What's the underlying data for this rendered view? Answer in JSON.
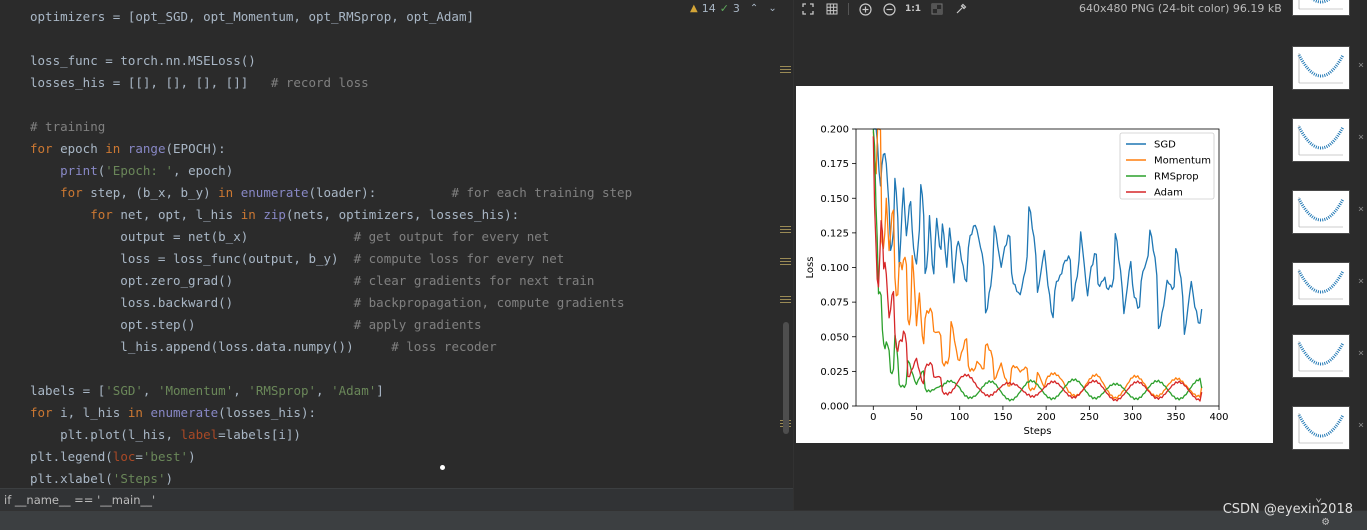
{
  "editor": {
    "lines": [
      [
        [
          "optimizers = [opt_SGD, opt_Momentum, opt_RMSprop, opt_Adam]",
          "plain"
        ]
      ],
      [],
      [
        [
          "loss_func = torch.nn.MSELoss()",
          "plain"
        ]
      ],
      [
        [
          "losses_his = [[], [], [], []]   ",
          "plain"
        ],
        [
          "# record loss",
          "com"
        ]
      ],
      [],
      [
        [
          "# training",
          "com"
        ]
      ],
      [
        [
          "for",
          "kw"
        ],
        [
          " epoch ",
          "plain"
        ],
        [
          "in",
          "kw"
        ],
        [
          " ",
          "plain"
        ],
        [
          "range",
          "fn"
        ],
        [
          "(EPOCH):",
          "plain"
        ]
      ],
      [
        [
          "    ",
          "plain"
        ],
        [
          "print",
          "fn"
        ],
        [
          "(",
          "plain"
        ],
        [
          "'Epoch: '",
          "str"
        ],
        [
          ", epoch)",
          "plain"
        ]
      ],
      [
        [
          "    ",
          "plain"
        ],
        [
          "for",
          "kw"
        ],
        [
          " step, (b_x, b_y) ",
          "plain"
        ],
        [
          "in",
          "kw"
        ],
        [
          " ",
          "plain"
        ],
        [
          "enumerate",
          "fn"
        ],
        [
          "(loader):          ",
          "plain"
        ],
        [
          "# for each training step",
          "com"
        ]
      ],
      [
        [
          "        ",
          "plain"
        ],
        [
          "for",
          "kw"
        ],
        [
          " net, opt, l_his ",
          "plain"
        ],
        [
          "in",
          "kw"
        ],
        [
          " ",
          "plain"
        ],
        [
          "zip",
          "fn"
        ],
        [
          "(nets, optimizers, losses_his):",
          "plain"
        ]
      ],
      [
        [
          "            output = net(b_x)              ",
          "plain"
        ],
        [
          "# get output for every net",
          "com"
        ]
      ],
      [
        [
          "            loss = loss_func(output, b_y)  ",
          "plain"
        ],
        [
          "# compute loss for every net",
          "com"
        ]
      ],
      [
        [
          "            opt.zero_grad()                ",
          "plain"
        ],
        [
          "# clear gradients for next train",
          "com"
        ]
      ],
      [
        [
          "            loss.backward()                ",
          "plain"
        ],
        [
          "# backpropagation, compute gradients",
          "com"
        ]
      ],
      [
        [
          "            opt.step()                     ",
          "plain"
        ],
        [
          "# apply gradients",
          "com"
        ]
      ],
      [
        [
          "            l_his.append(loss.data.numpy())     ",
          "plain"
        ],
        [
          "# loss recoder",
          "com"
        ]
      ],
      [],
      [
        [
          "labels = [",
          "plain"
        ],
        [
          "'SGD'",
          "str"
        ],
        [
          ", ",
          "plain"
        ],
        [
          "'Momentum'",
          "str"
        ],
        [
          ", ",
          "plain"
        ],
        [
          "'RMSprop'",
          "str"
        ],
        [
          ", ",
          "plain"
        ],
        [
          "'Adam'",
          "str"
        ],
        [
          "]",
          "plain"
        ]
      ],
      [
        [
          "for",
          "kw"
        ],
        [
          " i, l_his ",
          "plain"
        ],
        [
          "in",
          "kw"
        ],
        [
          " ",
          "plain"
        ],
        [
          "enumerate",
          "fn"
        ],
        [
          "(losses_his):",
          "plain"
        ]
      ],
      [
        [
          "    plt.plot(l_his, ",
          "plain"
        ],
        [
          "label",
          "param"
        ],
        [
          "=labels[i])",
          "plain"
        ]
      ],
      [
        [
          "plt.legend(",
          "plain"
        ],
        [
          "loc",
          "param"
        ],
        [
          "=",
          "plain"
        ],
        [
          "'best'",
          "str"
        ],
        [
          ")",
          "plain"
        ]
      ],
      [
        [
          "plt.xlabel(",
          "plain"
        ],
        [
          "'Steps'",
          "str"
        ],
        [
          ")",
          "plain"
        ]
      ]
    ],
    "warnings_count": "14",
    "ok_count": "3",
    "breadcrumb": "if __name__ == '__main__'"
  },
  "viewer": {
    "image_info": "640x480 PNG (24-bit color) 96.19 kB",
    "toolbar_icons": [
      "fit-screen-icon",
      "grid-icon",
      "zoom-in-icon",
      "zoom-out-icon",
      "actual-size-icon",
      "background-icon",
      "color-picker-icon"
    ],
    "actual_size_label": "1:1"
  },
  "watermark": "CSDN @eyexin2018",
  "chart_data": {
    "type": "line",
    "xlabel": "Steps",
    "ylabel": "Loss",
    "xlim": [
      -20,
      400
    ],
    "ylim": [
      0.0,
      0.2
    ],
    "xticks": [
      "0",
      "50",
      "100",
      "150",
      "200",
      "250",
      "300",
      "350",
      "400"
    ],
    "yticks": [
      "0.000",
      "0.025",
      "0.050",
      "0.075",
      "0.100",
      "0.125",
      "0.150",
      "0.175",
      "0.200"
    ],
    "legend_position": "upper-right",
    "series": [
      {
        "name": "SGD",
        "color": "#1f77b4",
        "x": [
          0,
          5,
          10,
          15,
          20,
          25,
          30,
          35,
          40,
          45,
          50,
          55,
          60,
          65,
          70,
          75,
          80,
          85,
          90,
          95,
          100,
          110,
          120,
          130,
          140,
          150,
          160,
          170,
          180,
          190,
          200,
          210,
          220,
          230,
          240,
          250,
          260,
          270,
          280,
          290,
          300,
          310,
          320,
          330,
          340,
          350,
          360,
          370,
          380
        ],
        "y": [
          0.2,
          0.2,
          0.16,
          0.18,
          0.12,
          0.15,
          0.11,
          0.16,
          0.12,
          0.14,
          0.1,
          0.15,
          0.11,
          0.13,
          0.09,
          0.14,
          0.12,
          0.1,
          0.13,
          0.09,
          0.12,
          0.1,
          0.13,
          0.08,
          0.12,
          0.1,
          0.11,
          0.08,
          0.13,
          0.09,
          0.11,
          0.07,
          0.1,
          0.09,
          0.12,
          0.08,
          0.1,
          0.09,
          0.11,
          0.07,
          0.1,
          0.08,
          0.12,
          0.07,
          0.09,
          0.1,
          0.06,
          0.09,
          0.07
        ]
      },
      {
        "name": "Momentum",
        "color": "#ff7f0e",
        "x": [
          0,
          5,
          10,
          15,
          20,
          25,
          30,
          35,
          40,
          45,
          50,
          55,
          60,
          70,
          80,
          90,
          100,
          110,
          120,
          130,
          140,
          150,
          160,
          170,
          180,
          190,
          200,
          220,
          240,
          260,
          280,
          300,
          320,
          340,
          360,
          380
        ],
        "y": [
          0.2,
          0.19,
          0.15,
          0.14,
          0.11,
          0.12,
          0.09,
          0.1,
          0.08,
          0.09,
          0.06,
          0.08,
          0.05,
          0.06,
          0.04,
          0.05,
          0.03,
          0.04,
          0.03,
          0.035,
          0.025,
          0.03,
          0.02,
          0.025,
          0.02,
          0.02,
          0.015,
          0.018,
          0.012,
          0.016,
          0.012,
          0.015,
          0.013,
          0.015,
          0.012,
          0.014
        ]
      },
      {
        "name": "RMSprop",
        "color": "#2ca02c",
        "x": [
          0,
          3,
          6,
          9,
          12,
          15,
          20,
          25,
          30,
          40,
          50,
          60,
          80,
          100,
          120,
          140,
          160,
          180,
          200,
          240,
          280,
          320,
          360,
          380
        ],
        "y": [
          0.2,
          0.12,
          0.07,
          0.09,
          0.06,
          0.05,
          0.03,
          0.04,
          0.02,
          0.025,
          0.015,
          0.02,
          0.01,
          0.015,
          0.01,
          0.012,
          0.01,
          0.012,
          0.011,
          0.013,
          0.01,
          0.012,
          0.011,
          0.013
        ]
      },
      {
        "name": "Adam",
        "color": "#d62728",
        "x": [
          0,
          3,
          6,
          9,
          12,
          15,
          20,
          25,
          30,
          35,
          40,
          50,
          60,
          70,
          80,
          100,
          120,
          140,
          160,
          180,
          200,
          240,
          280,
          320,
          360,
          380
        ],
        "y": [
          0.2,
          0.15,
          0.1,
          0.12,
          0.08,
          0.09,
          0.06,
          0.07,
          0.04,
          0.05,
          0.03,
          0.035,
          0.02,
          0.025,
          0.015,
          0.018,
          0.012,
          0.015,
          0.01,
          0.014,
          0.011,
          0.013,
          0.01,
          0.012,
          0.011,
          0.01
        ]
      }
    ]
  }
}
